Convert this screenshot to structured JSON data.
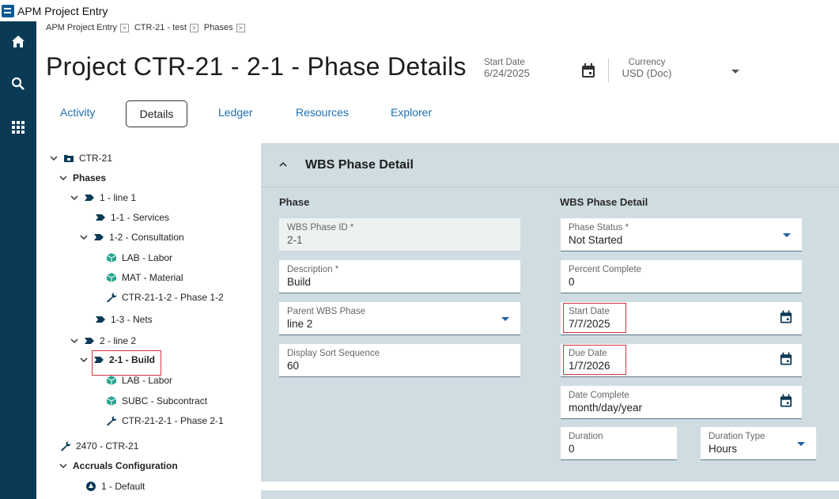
{
  "app": {
    "title": "APM Project Entry"
  },
  "rail": {
    "items": [
      "home-icon",
      "search-icon",
      "apps-grid-icon"
    ]
  },
  "breadcrumb": {
    "items": [
      "APM Project Entry",
      "CTR-21 - test",
      "Phases"
    ],
    "separator": ">"
  },
  "header": {
    "title": "Project CTR-21 - 2-1 - Phase Details",
    "start_date_label": "Start Date",
    "start_date_value": "6/24/2025",
    "currency_label": "Currency",
    "currency_value": "USD (Doc)"
  },
  "tabs": [
    {
      "label": "Activity"
    },
    {
      "label": "Details",
      "active": true
    },
    {
      "label": "Ledger"
    },
    {
      "label": "Resources"
    },
    {
      "label": "Explorer"
    }
  ],
  "tree": {
    "root": "CTR-21",
    "phases": "Phases",
    "line1": "1 - line 1",
    "services": "1-1 - Services",
    "consultation": "1-2 - Consultation",
    "lab1": "LAB - Labor",
    "mat1": "MAT - Material",
    "phase12": "CTR-21-1-2 - Phase 1-2",
    "nets": "1-3 - Nets",
    "line2": "2 - line 2",
    "build": "2-1 - Build",
    "lab2": "LAB - Labor",
    "subc": "SUBC - Subcontract",
    "phase21": "CTR-21-2-1 - Phase 2-1",
    "ctr2470": "2470 - CTR-21",
    "accruals": "Accruals Configuration",
    "default": "1 - Default"
  },
  "panel": {
    "title": "WBS Phase Detail",
    "left_section": "Phase",
    "right_section": "WBS Phase Detail",
    "wbs_phase_id": {
      "label": "WBS Phase ID *",
      "value": "2-1"
    },
    "description": {
      "label": "Description *",
      "value": "Build"
    },
    "parent_wbs_phase": {
      "label": "Parent WBS Phase",
      "value": "line 2"
    },
    "display_sort_sequence": {
      "label": "Display Sort Sequence",
      "value": "60"
    },
    "phase_status": {
      "label": "Phase Status *",
      "value": "Not Started"
    },
    "percent_complete": {
      "label": "Percent Complete",
      "value": "0"
    },
    "start_date": {
      "label": "Start Date",
      "value": "7/7/2025"
    },
    "due_date": {
      "label": "Due Date",
      "value": "1/7/2026"
    },
    "date_complete": {
      "label": "Date Complete",
      "value": "month/day/year"
    },
    "duration": {
      "label": "Duration",
      "value": "0"
    },
    "duration_type": {
      "label": "Duration Type",
      "value": "Hours"
    }
  },
  "colors": {
    "rail": "#0b3a56",
    "panel": "#cfdde2",
    "link": "#1e6fb0",
    "highlight": "#d9333f"
  }
}
